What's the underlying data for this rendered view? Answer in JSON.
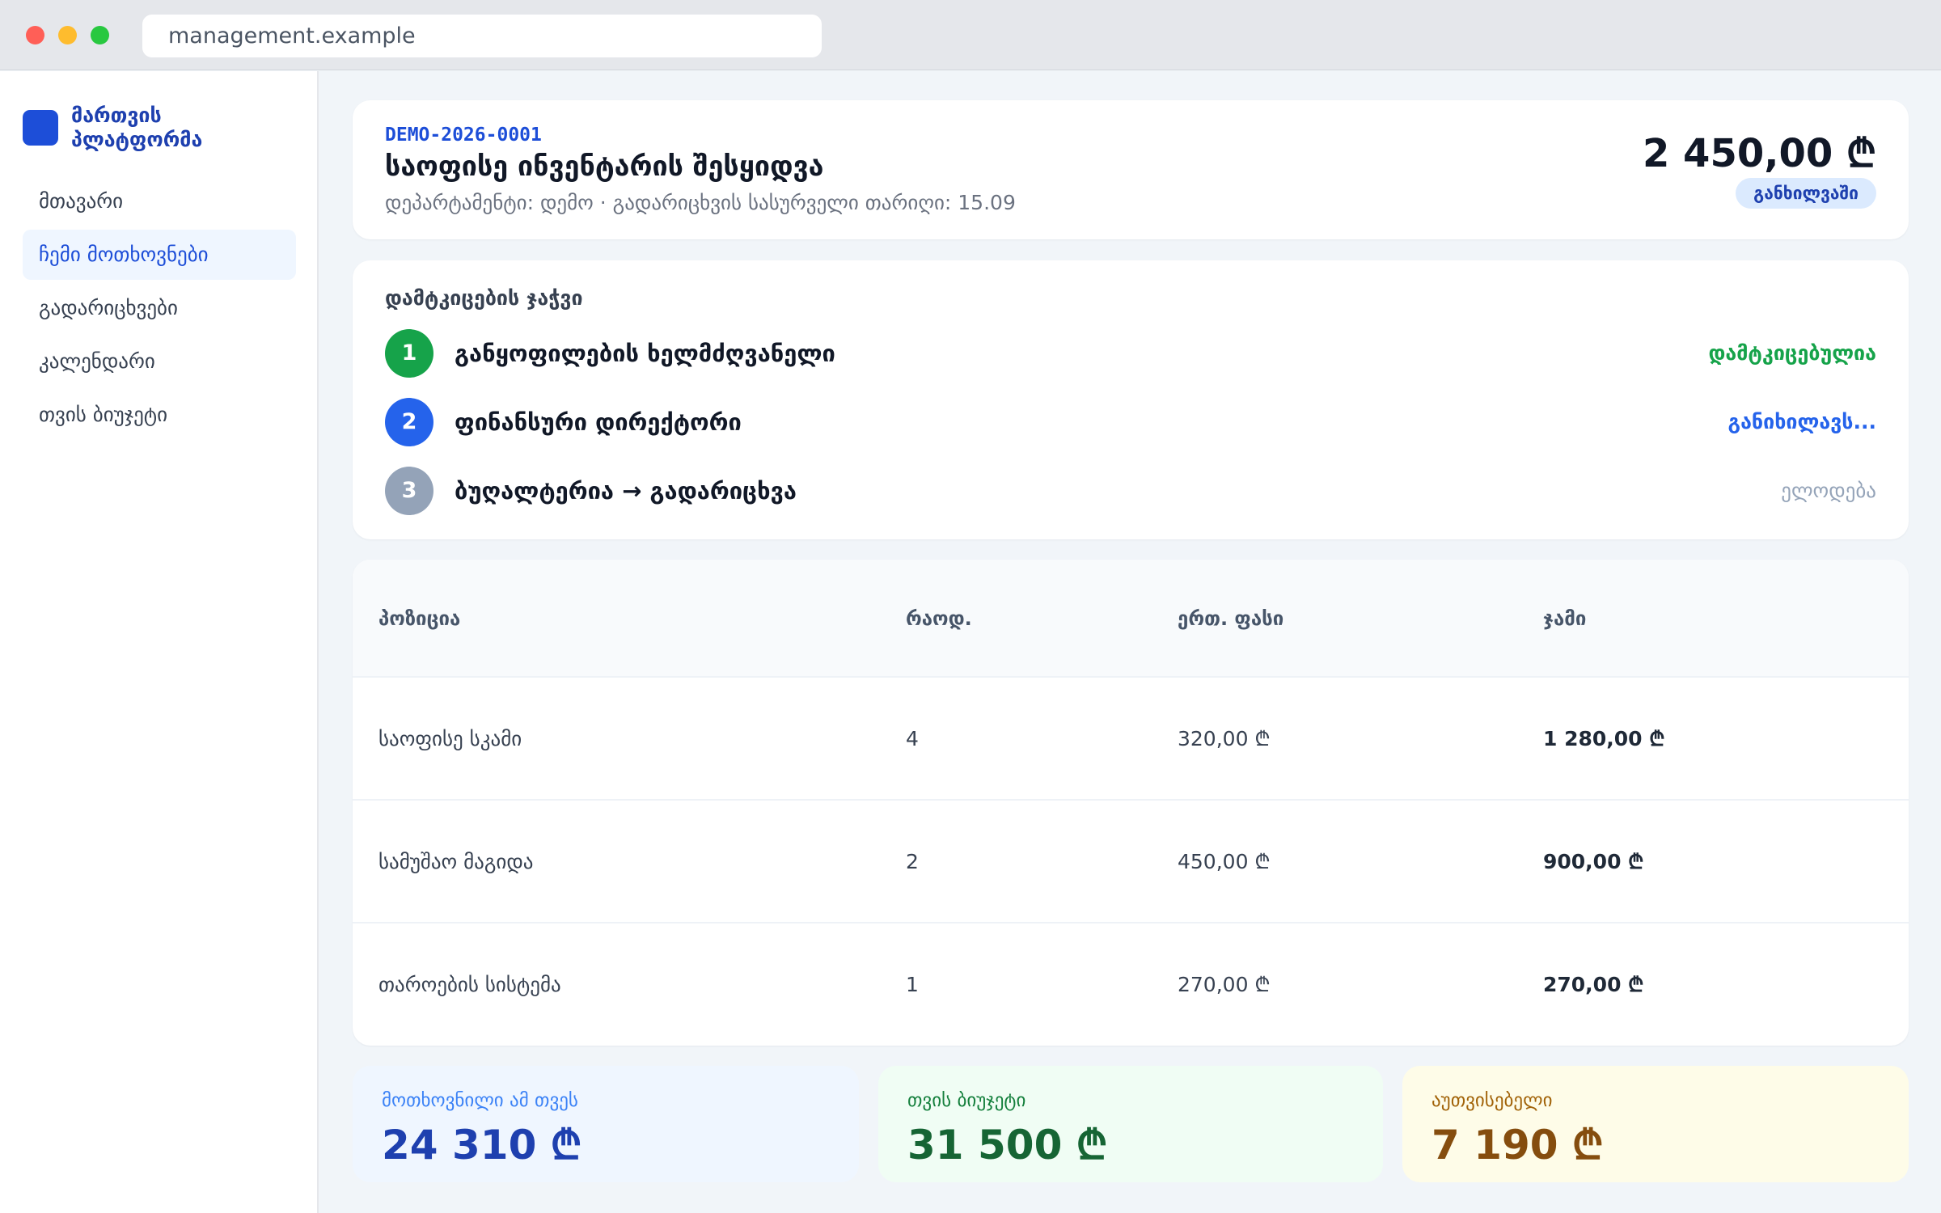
{
  "browser": {
    "url": "management.example"
  },
  "sidebar": {
    "brand": "მართვის პლატფორმა",
    "items": [
      {
        "label": "მთავარი"
      },
      {
        "label": "ჩემი მოთხოვნები",
        "active": true
      },
      {
        "label": "გადარიცხვები"
      },
      {
        "label": "კალენდარი"
      },
      {
        "label": "თვის ბიუჯეტი"
      }
    ]
  },
  "request": {
    "id": "DEMO-2026-0001",
    "title": "საოფისე ინვენტარის შესყიდვა",
    "subtitle": "დეპარტამენტი: დემო · გადარიცხვის სასურველი თარიღი: 15.09",
    "amount": "2 450,00 ₾",
    "status": "განხილვაში"
  },
  "approval": {
    "title": "დამტკიცების ჯაჭვი",
    "steps": [
      {
        "num": "1",
        "label": "განყოფილების ხელმძღვანელი",
        "status": "დამტკიცებულია",
        "color": "#16a34a"
      },
      {
        "num": "2",
        "label": "ფინანსური დირექტორი",
        "status": "განიხილავს...",
        "color": "#2563eb"
      },
      {
        "num": "3",
        "label": "ბუღალტერია → გადარიცხვა",
        "status": "ელოდება",
        "color": "#94a3b8"
      }
    ]
  },
  "table": {
    "headers": [
      "პოზიცია",
      "რაოდ.",
      "ერთ. ფასი",
      "ჯამი"
    ],
    "rows": [
      [
        "საოფისე სკამი",
        "4",
        "320,00 ₾",
        "1 280,00 ₾"
      ],
      [
        "სამუშაო მაგიდა",
        "2",
        "450,00 ₾",
        "900,00 ₾"
      ],
      [
        "თაროების სისტემა",
        "1",
        "270,00 ₾",
        "270,00 ₾"
      ]
    ]
  },
  "stats": [
    {
      "label": "მოთხოვნილი ამ თვეს",
      "value": "24 310 ₾",
      "label_color": "#3b82f6",
      "value_color": "#1e40af"
    },
    {
      "label": "თვის ბიუჯეტი",
      "value": "31 500 ₾",
      "label_color": "#15803d",
      "value_color": "#166534"
    },
    {
      "label": "აუთვისებელი",
      "value": "7 190 ₾",
      "label_color": "#a16207",
      "value_color": "#854d0e"
    }
  ]
}
